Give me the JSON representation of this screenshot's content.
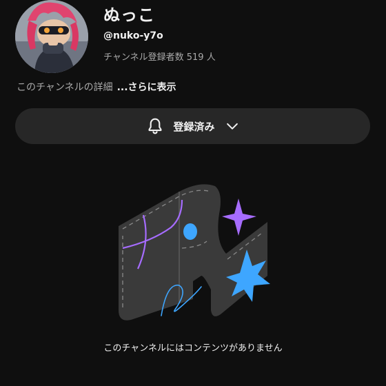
{
  "channel": {
    "name": "ぬっこ",
    "handle": "@nuko-y7o",
    "subscribers": "チャンネル登録者数 519 人",
    "description": "このチャンネルの詳細",
    "more_label": "...さらに表示"
  },
  "subscribe_button": {
    "label": "登録済み",
    "icon": "bell-icon",
    "dropdown_icon": "chevron-down-icon",
    "background": "#272727"
  },
  "empty_state": {
    "message": "このチャンネルにはコンテンツがありません"
  },
  "colors": {
    "background": "#0f0f0f",
    "text_primary": "#f1f1f1",
    "text_secondary": "#aaaaaa",
    "accent_purple": "#a66cff",
    "accent_blue": "#3ea6ff"
  }
}
